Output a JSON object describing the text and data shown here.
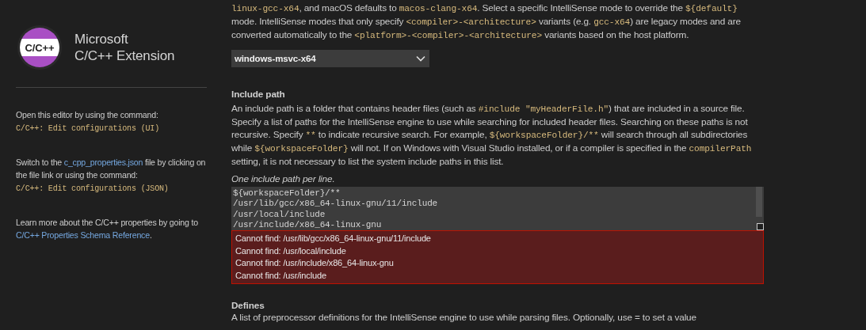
{
  "sidebar": {
    "logo_text": "C/C++",
    "title_lines": [
      "Microsoft",
      "C/C++ Extension"
    ],
    "notes": [
      [
        {
          "kind": "text",
          "text": "Open this editor by using the command:"
        },
        {
          "kind": "break"
        },
        {
          "kind": "code",
          "text": "C/C++: Edit configurations (UI)"
        }
      ],
      [
        {
          "kind": "text",
          "text": "Switch to the "
        },
        {
          "kind": "link",
          "text": "c_cpp_properties.json"
        },
        {
          "kind": "text",
          "text": " file by clicking on the file link or using the command:"
        },
        {
          "kind": "break"
        },
        {
          "kind": "code",
          "text": "C/C++: Edit configurations (JSON)"
        }
      ],
      [
        {
          "kind": "text",
          "text": "Learn more about the C/C++ properties by going to "
        },
        {
          "kind": "link",
          "text": "C/C++ Properties Schema Reference"
        },
        {
          "kind": "text",
          "text": "."
        }
      ]
    ]
  },
  "intellisense_mode": {
    "description": [
      {
        "kind": "code",
        "text": "linux-gcc-x64"
      },
      {
        "kind": "text",
        "text": ", and macOS defaults to "
      },
      {
        "kind": "code",
        "text": "macos-clang-x64"
      },
      {
        "kind": "text",
        "text": ". Select a specific IntelliSense mode to override the "
      },
      {
        "kind": "code",
        "text": "${default}"
      },
      {
        "kind": "text",
        "text": " mode. IntelliSense modes that only specify "
      },
      {
        "kind": "code",
        "text": "<compiler>-<architecture>"
      },
      {
        "kind": "text",
        "text": " variants (e.g. "
      },
      {
        "kind": "code",
        "text": "gcc-x64"
      },
      {
        "kind": "text",
        "text": ") are legacy modes and are converted automatically to the "
      },
      {
        "kind": "code",
        "text": "<platform>-<compiler>-<architecture>"
      },
      {
        "kind": "text",
        "text": " variants based on the host platform."
      }
    ],
    "value": "windows-msvc-x64"
  },
  "include_path": {
    "heading": "Include path",
    "description": [
      {
        "kind": "text",
        "text": "An include path is a folder that contains header files (such as "
      },
      {
        "kind": "code",
        "text": "#include \"myHeaderFile.h\""
      },
      {
        "kind": "text",
        "text": ") that are included in a source file. Specify a list of paths for the IntelliSense engine to use while searching for included header files. Searching on these paths is not recursive. Specify "
      },
      {
        "kind": "code",
        "text": "**"
      },
      {
        "kind": "text",
        "text": " to indicate recursive search. For example, "
      },
      {
        "kind": "code",
        "text": "${workspaceFolder}/**"
      },
      {
        "kind": "text",
        "text": " will search through all subdirectories while "
      },
      {
        "kind": "code",
        "text": "${workspaceFolder}"
      },
      {
        "kind": "text",
        "text": " will not. If on Windows with Visual Studio installed, or if a compiler is specified in the "
      },
      {
        "kind": "code",
        "text": "compilerPath"
      },
      {
        "kind": "text",
        "text": " setting, it is not necessary to list the system include paths in this list."
      }
    ],
    "hint": "One include path per line.",
    "lines": [
      "${workspaceFolder}/**",
      "/usr/lib/gcc/x86_64-linux-gnu/11/include",
      "/usr/local/include",
      "/usr/include/x86_64-linux-gnu"
    ],
    "errors": [
      "Cannot find: /usr/lib/gcc/x86_64-linux-gnu/11/include",
      "Cannot find: /usr/local/include",
      "Cannot find: /usr/include/x86_64-linux-gnu",
      "Cannot find: /usr/include"
    ]
  },
  "defines": {
    "heading": "Defines",
    "description": "A list of preprocessor definitions for the IntelliSense engine to use while parsing files. Optionally, use = to set a value"
  }
}
